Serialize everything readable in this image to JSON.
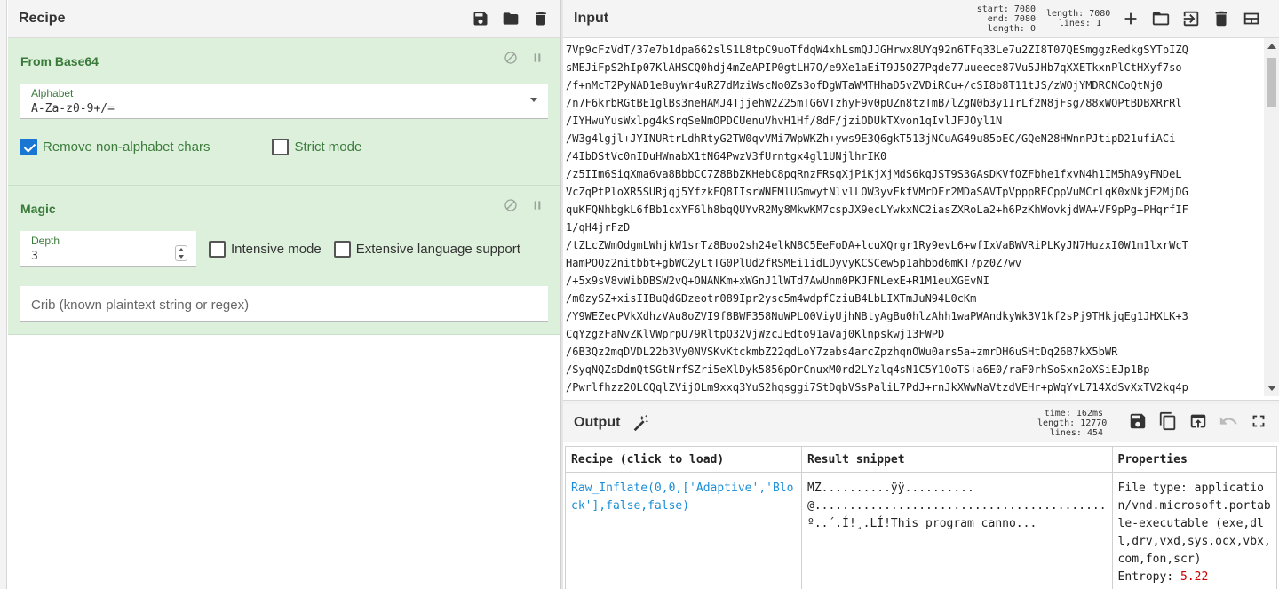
{
  "recipe": {
    "title": "Recipe",
    "icons": [
      "save-icon",
      "folder-icon",
      "trash-icon"
    ],
    "operations": [
      {
        "name": "From Base64",
        "alphabet_label": "Alphabet",
        "alphabet_value": "A-Za-z0-9+/=",
        "remove_nonalpha_label": "Remove non-alphabet chars",
        "remove_nonalpha_checked": true,
        "strict_label": "Strict mode",
        "strict_checked": false
      },
      {
        "name": "Magic",
        "depth_label": "Depth",
        "depth_value": "3",
        "intensive_label": "Intensive mode",
        "extensive_label": "Extensive language support",
        "crib_placeholder": "Crib (known plaintext string or regex)"
      }
    ]
  },
  "input": {
    "title": "Input",
    "stats": {
      "start_label": "start:",
      "start": "7080",
      "end_label": "end:",
      "end": "7080",
      "length_label": "length:",
      "sel_length": "0",
      "total_length_label": "length:",
      "total_length": "7080",
      "lines_label": "lines:",
      "lines": "1"
    },
    "lines": [
      "7Vp9cFzVdT/37e7b1dpa662slS1L8tpC9uoTfdqW4xhLsmQJJGHrwx8UYq92n6TFq33Le7u2ZI8T07QESmggzRedkgSYTpIZQ",
      "sMEJiFpS2hIp07KlAHSCQ0hdj4mZeAPIP0gtLH7O/e9Xe1aEiT9J5OZ7Pqde77uueece87Vu5JHb7qXXETkxnPlCtHXyf7so",
      "/f+nMcT2PyNAD1e8uyWr4uRZ7dMziWscNo0Zs3ofDgWTaWMTHhaD5vZVDiRCu+/cSI8b8T11tJS/zWOjYMDRCNCoQtNj0",
      "/n7F6krbRGtBE1glBs3neHAMJ4TjjehW2Z25mTG6VTzhyF9v0pUZn8tzTmB/lZgN0b3y1IrLf2N8jFsg/88xWQPtBDBXRrRl",
      "/IYHwuYusWxlpg4kSrqSeNmOPDCUenuVhvH1Hf/8dF/jziODUkTXvon1qIvlJFJOyl1N",
      "/W3g4lgjl+JYINURtrLdhRtyG2TW0qvVMi7WpWKZh+yws9E3Q6gkT513jNCuAG49u85oEC/GQeN28HWnnPJtipD21ufiACi",
      "/4IbDStVc0nIDuHWnabX1tN64PwzV3fUrntgx4gl1UNjlhrIK0",
      "/z5IIm6SiqXma6va8BbbCC7Z8BbZKHebC8pqRnzFRsqXjPiKjXjMdS6kqJST9S3GAsDKVfOZFbhe1fxvN4h1IM5hA9yFNDeL",
      "VcZqPtPloXR5SURjqj5YfzkEQ8IIsrWNEMlUGmwytNlvlLOW3yvFkfVMrDFr2MDaSAVTpVpppRECppVuMCrlqK0xNkjE2MjDG",
      "quKFQNhbgkL6fBb1cxYF6lh8bqQUYvR2My8MkwKM7cspJX9ecLYwkxNC2iasZXRoLa2+h6PzKhWovkjdWA+VF9pPg+PHqrfIF",
      "1/qH4jrFzD",
      "/tZLcZWmOdgmLWhjkW1srTz8Boo2sh24elkN8C5EeFoDA+lcuXQrgr1Ry9evL6+wfIxVaBWVRiPLKyJN7HuzxI0W1m1lxrWcT",
      "HamPOQz2nitbbt+gbWC2yLtTG0PlUd2fRSMEi1idLDyvyKCSCew5p1ahbbd6mKT7pz0Z7wv",
      "/+5x9sV8vWibDBSW2vQ+ONANKm+xWGnJ1lWTd7AwUnm0PKJFNLexE+R1M1euXGEvNI",
      "/m0zySZ+xisIIBuQdGDzeotr089Ipr2ysc5m4wdpfCziuB4LbLIXTmJuN94L0cKm",
      "/Y9WEZecPVkXdhzVAu8oZVI9f8BWF358NuWPLO0ViyUjhNBtyAgBu0hlzAhh1waPWAndkyWk3V1kf2sPj9THkjqEg1JHXLK+3",
      "CqYzgzFaNvZKlVWprpU79RltpQ32VjWzcJEdto91aVaj0Klnpskwj13FWPD",
      "/6B3Qz2mqDVDL22b3Vy0NVSKvKtckmbZ22qdLoY7zabs4arcZpzhqnOWu0ars5a+zmrDH6uSHtDq26B7kX5bWR",
      "/SyqNQZsDdmQtSGtNrfSZri5eXlDyk5856pOrCnuxM0rd2LYzlq4sN1C5Y1OoTS+a6E0/raF0rhSoSxn2oXSiEJp1Bp",
      "/Pwrlfhzz2OLCQqlZVijOLm9xxq3YuS2hqsggi7StDqbVSsPaliL7PdJ+rnJkXWwNaVtzdVEHr+pWqYvL714XdSvXxTV2kq4p"
    ]
  },
  "output": {
    "title": "Output",
    "stats": {
      "time_label": "time:",
      "time": "162ms",
      "length_label": "length:",
      "length": "12770",
      "lines_label": "lines:",
      "lines": "454"
    },
    "table": {
      "headers": [
        "Recipe (click to load)",
        "Result snippet",
        "Properties"
      ],
      "rows": [
        {
          "recipe": "Raw_Inflate(0,0,['Adaptive','Block'],false,false)",
          "snippet": "MZ..........ÿÿ..........@..........................................º..´.Í!¸.LÍ!This program canno...",
          "properties_filetype": "File type: application/vnd.microsoft.portable-executable (exe,dll,drv,vxd,sys,ocx,vbx,com,fon,scr)",
          "entropy_label": "Entropy: ",
          "entropy_value": "5.22"
        }
      ]
    }
  },
  "colors": {
    "op_background": "#dcf0dc",
    "op_title": "#3a7a3a",
    "checkbox_checked": "#1976d2",
    "link": "#1a8ed6",
    "entropy": "#cc0000"
  }
}
